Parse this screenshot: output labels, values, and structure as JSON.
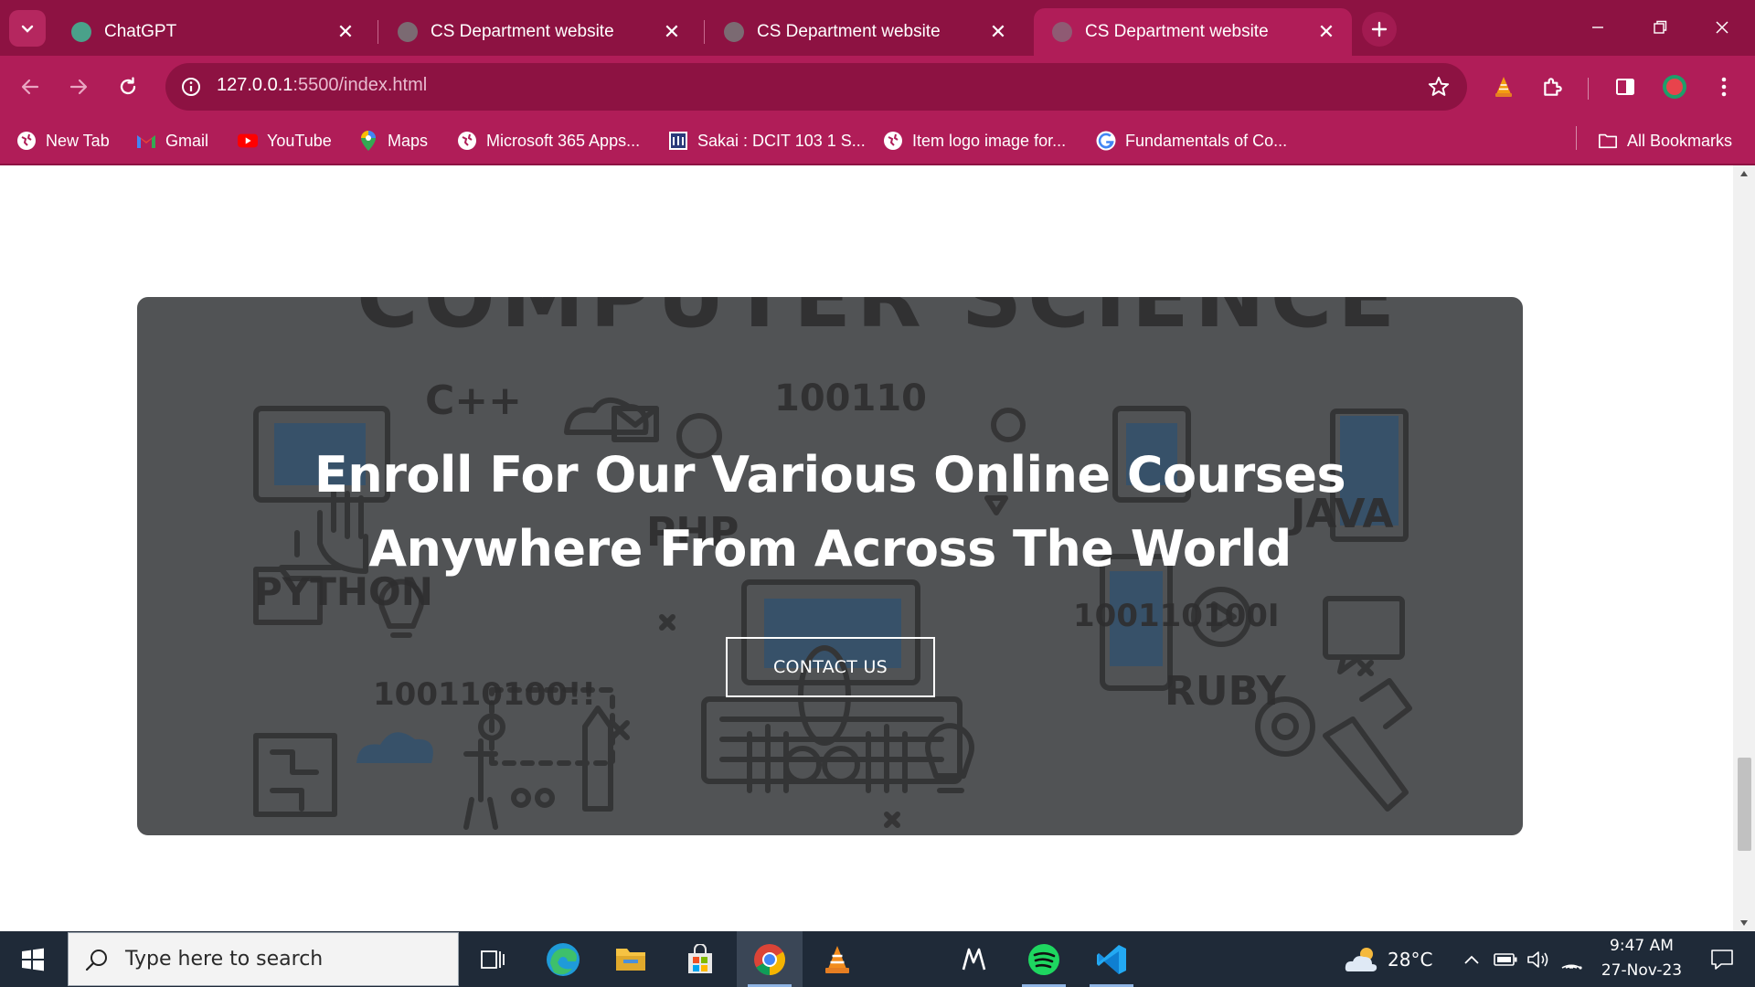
{
  "browser": {
    "tabs": [
      {
        "title": "ChatGPT",
        "active": false,
        "favicon": "chatgpt-icon"
      },
      {
        "title": "CS Department website",
        "active": false,
        "favicon": "globe-icon"
      },
      {
        "title": "CS Department website",
        "active": false,
        "favicon": "globe-icon"
      },
      {
        "title": "CS Department website",
        "active": true,
        "favicon": "globe-icon"
      }
    ],
    "address_bar": {
      "host": "127.0.0.1",
      "path": ":5500/index.html"
    },
    "bookmarks": [
      {
        "label": "New Tab",
        "icon": "globe-icon"
      },
      {
        "label": "Gmail",
        "icon": "gmail-icon"
      },
      {
        "label": "YouTube",
        "icon": "youtube-icon"
      },
      {
        "label": "Maps",
        "icon": "maps-icon"
      },
      {
        "label": "Microsoft 365 Apps...",
        "icon": "globe-icon"
      },
      {
        "label": "Sakai : DCIT 103 1 S...",
        "icon": "sakai-icon"
      },
      {
        "label": "Item logo image for...",
        "icon": "globe-icon"
      },
      {
        "label": "Fundamentals of Co...",
        "icon": "google-icon"
      }
    ],
    "all_bookmarks_label": "All Bookmarks"
  },
  "page": {
    "hero": {
      "heading_line1": "Enroll For Our Various Online Courses",
      "heading_line2": "Anywhere From Across The World",
      "button_label": "CONTACT US",
      "background_words": {
        "banner": "COMPUTER SCIENCE",
        "cpp": "C++",
        "binary1": "100110",
        "php": "PHP",
        "java": "JAVA",
        "python": "PYTHON",
        "binary2": "100110100I",
        "binary3": "100110100!!",
        "ruby": "RUBY"
      }
    }
  },
  "taskbar": {
    "search_placeholder": "Type here to search",
    "weather": "28°C",
    "time": "9:47 AM",
    "date": "27-Nov-23"
  },
  "colors": {
    "chrome_frame": "#8d1242",
    "chrome_toolbar": "#b01d58",
    "taskbar": "#1f2a38"
  }
}
